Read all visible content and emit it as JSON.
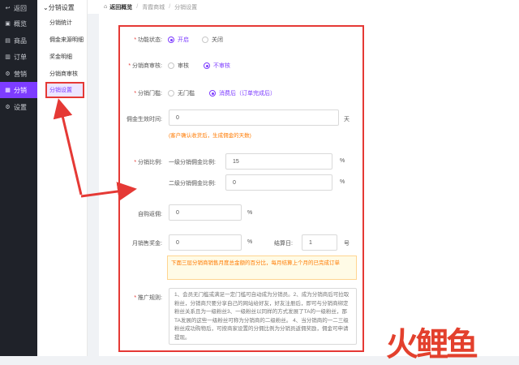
{
  "sidebar": {
    "items": [
      {
        "label": "返回",
        "icon": "back-icon",
        "glyph": "↩"
      },
      {
        "label": "概览",
        "icon": "dashboard-icon",
        "glyph": "▣"
      },
      {
        "label": "商品",
        "icon": "goods-icon",
        "glyph": "▤"
      },
      {
        "label": "订单",
        "icon": "order-icon",
        "glyph": "▥"
      },
      {
        "label": "营销",
        "icon": "marketing-icon",
        "glyph": "⚙"
      },
      {
        "label": "分销",
        "icon": "distribution-icon",
        "glyph": "▦"
      },
      {
        "label": "设置",
        "icon": "settings-icon",
        "glyph": "⚙"
      }
    ]
  },
  "submenu": {
    "header": "⌄分销设置",
    "items": [
      "分销统计",
      "佣金来源明细",
      "奖金明细",
      "分销商审核",
      "分销设置"
    ]
  },
  "breadcrumb": {
    "home": "返回概览",
    "items": [
      "青霞商城",
      "分销设置"
    ]
  },
  "form": {
    "status": {
      "label": "功能状态:",
      "options": [
        "开启",
        "关闭"
      ]
    },
    "audit": {
      "label": "分销商审核:",
      "options": [
        "审核",
        "不审核"
      ]
    },
    "threshold": {
      "label": "分销门槛:",
      "options": [
        "无门槛",
        "消费后（订单完成后）"
      ]
    },
    "effective_time": {
      "label": "佣金生效时间:",
      "value": "0",
      "unit": "天",
      "hint": "(客户确认收货后，生成佣金的天数)"
    },
    "ratio": {
      "label": "分销比例:",
      "level1_label": "一级分销佣金比例:",
      "level1_value": "15",
      "level2_label": "二级分销佣金比例:",
      "level2_value": "0",
      "unit": "%"
    },
    "self_rebate": {
      "label": "自购返佣:",
      "value": "0",
      "unit": "%"
    },
    "monthly_bonus": {
      "label": "月销售奖金:",
      "value": "0",
      "unit": "%",
      "settle_label": "结算日:",
      "settle_value": "1",
      "settle_unit": "号"
    },
    "notice": "下面三层分销商销售月度总金额的百分比，每月结算上个月的已完成订单",
    "rules": {
      "label": "推广规则:",
      "text": "1、会员无门槛或满足一定门槛可自动成为分销员。2、成为分销商后可拉取粉丝，分销商只要分享自己的网站给好友，好友注册后，即可与分销商绑定粉丝关系且为一级粉丝3、一级粉丝以同样的方式发展了TA的一级粉丝，那TA发展的这些一级粉丝可称为分销商的二级粉丝。 4、当分销商的一二三级粉丝成功购物后，可按商家设置的分佣比例为分销员返佣奖励，佣金可申请提现。"
    }
  },
  "watermark": "火鲤鱼",
  "colors": {
    "accent": "#7d3cff",
    "highlight": "#e53935",
    "warning": "#ff7a00",
    "sidebar_bg": "#1f2229"
  }
}
